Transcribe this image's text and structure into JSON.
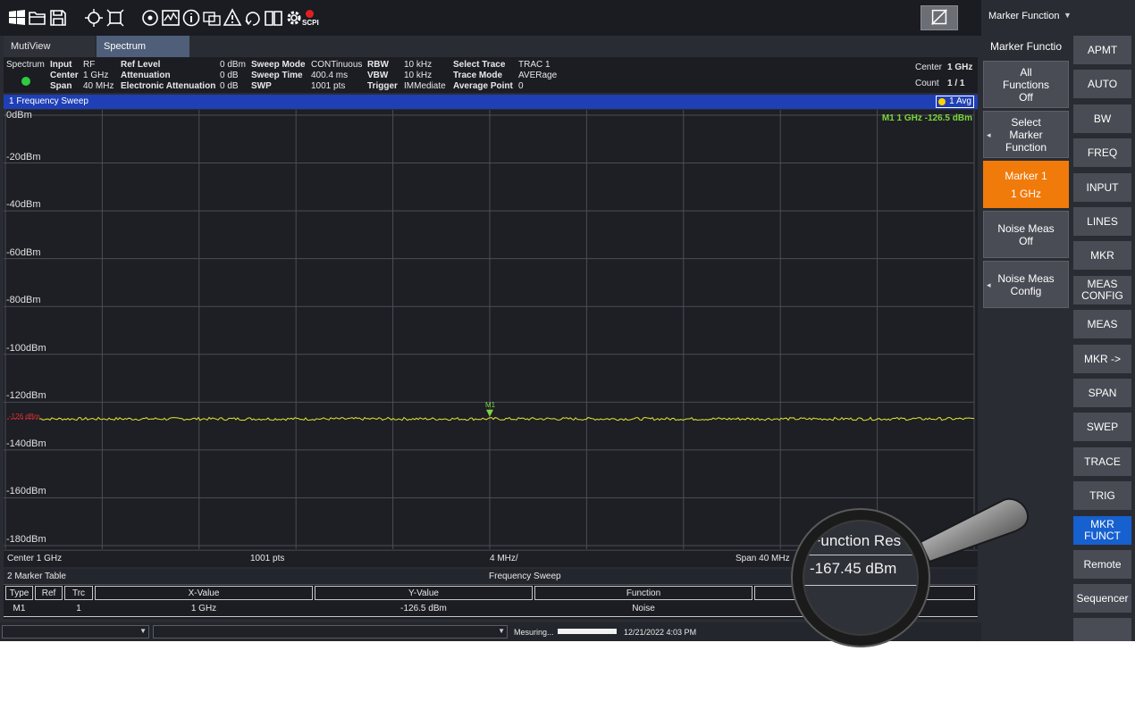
{
  "toolbar": {
    "scpi_label": "SCPI",
    "icons": [
      "windows-icon",
      "open-folder-icon",
      "save-icon",
      "zoom-icon",
      "multi-zoom-icon",
      "reset-icon",
      "overview-icon",
      "info-icon",
      "screenshot-icon",
      "warning-icon",
      "undo-icon",
      "help-book-icon",
      "settings-icon",
      "scpi-record-icon",
      "fullscreen-icon"
    ]
  },
  "header": {
    "menu_title": "Marker Function"
  },
  "tabs": [
    {
      "label": "MutiView"
    },
    {
      "label": "Spectrum"
    }
  ],
  "info": {
    "measurement": "Spectrum",
    "input_label": "Input",
    "input_value": "RF",
    "center_label": "Center",
    "center_value": "1 GHz",
    "span_label": "Span",
    "span_value": "40 MHz",
    "ref_level_label": "Ref Level",
    "ref_level_value": "0 dBm",
    "attenuation_label": "Attenuation",
    "attenuation_value": "0 dB",
    "elec_att_label": "Electronic Attenuation",
    "elec_att_value": "0 dB",
    "sweep_mode_label": "Sweep Mode",
    "sweep_mode_value": "CONTinuous",
    "sweep_time_label": "Sweep Time",
    "sweep_time_value": "400.4 ms",
    "swp_label": "SWP",
    "swp_value": "1001 pts",
    "rbw_label": "RBW",
    "rbw_value": "10 kHz",
    "vbw_label": "VBW",
    "vbw_value": "10 kHz",
    "trigger_label": "Trigger",
    "trigger_value": "IMMediate",
    "select_trace_label": "Select Trace",
    "select_trace_value": "TRAC 1",
    "trace_mode_label": "Trace Mode",
    "trace_mode_value": "AVERage",
    "avg_point_label": "Average Point",
    "avg_point_value": "0",
    "right_center_label": "Center",
    "right_center_value": "1 GHz",
    "count_label": "Count",
    "count_value": "1 / 1"
  },
  "trace_window": {
    "title": "1  Frequency Sweep",
    "avg_label": "1 Avg"
  },
  "plot": {
    "y_labels": [
      "0dBm",
      "-20dBm",
      "-40dBm",
      "-60dBm",
      "-80dBm",
      "-100dBm",
      "-120dBm",
      "-140dBm",
      "-160dBm",
      "-180dBm"
    ],
    "marker_readout": "M1   1 GHz    -126.5 dBm",
    "marker_name": "M1",
    "ref_marker_label": "-126 dBm",
    "colors": {
      "trace": "#e6e62e",
      "grid": "#4a4d56",
      "marker": "#7cd63a",
      "ref_marker": "#e03030"
    }
  },
  "chart_data": {
    "type": "line",
    "xlabel": "",
    "ylabel": "",
    "ylim": [
      -180,
      0
    ],
    "grid": true,
    "series": [
      {
        "values_note": "",
        "level": -127
      }
    ],
    "markers": [
      {
        "name": "M1",
        "x": "1 GHz",
        "y": -126.5
      }
    ]
  },
  "footer": {
    "center": "Center  1 GHz",
    "points": "1001 pts",
    "div": "4 MHz/",
    "span": "Span  40 MHz"
  },
  "marker_table": {
    "title": "2  Marker Table",
    "subtitle": "Frequency Sweep",
    "headers": [
      "Type",
      "Ref",
      "Trc",
      "X-Value",
      "Y-Value",
      "Function"
    ],
    "rows": [
      {
        "type": "M1",
        "ref": "",
        "trc": "1",
        "x": "1 GHz",
        "y": "-126.5 dBm",
        "func": "Noise"
      }
    ]
  },
  "status": {
    "measuring": "Mesuring...",
    "datetime": "12/21/2022 4:03 PM",
    "progress": 1.0
  },
  "softkeys": {
    "title": "Marker Functio",
    "items": [
      {
        "line1": "All",
        "line2": "Functions",
        "line3": "Off"
      },
      {
        "line1": "Select",
        "line2": "Marker",
        "line3": "Function"
      },
      {
        "line1": "Marker 1",
        "line2": "1 GHz"
      },
      {
        "line1": "Noise Meas",
        "line2": "Off"
      },
      {
        "line1": "Noise Meas",
        "line2": "Config"
      }
    ]
  },
  "hardkeys": [
    "APMT",
    "AUTO",
    "BW",
    "FREQ",
    "INPUT",
    "LINES",
    "MKR",
    "MEAS CONFIG",
    "MEAS",
    "MKR ->",
    "SPAN",
    "SWEP",
    "TRACE",
    "TRIG",
    "MKR FUNCT",
    "Remote",
    "Sequencer"
  ],
  "magnifier": {
    "result_label": "Function Res",
    "result_value": "-167.45 dBm"
  }
}
